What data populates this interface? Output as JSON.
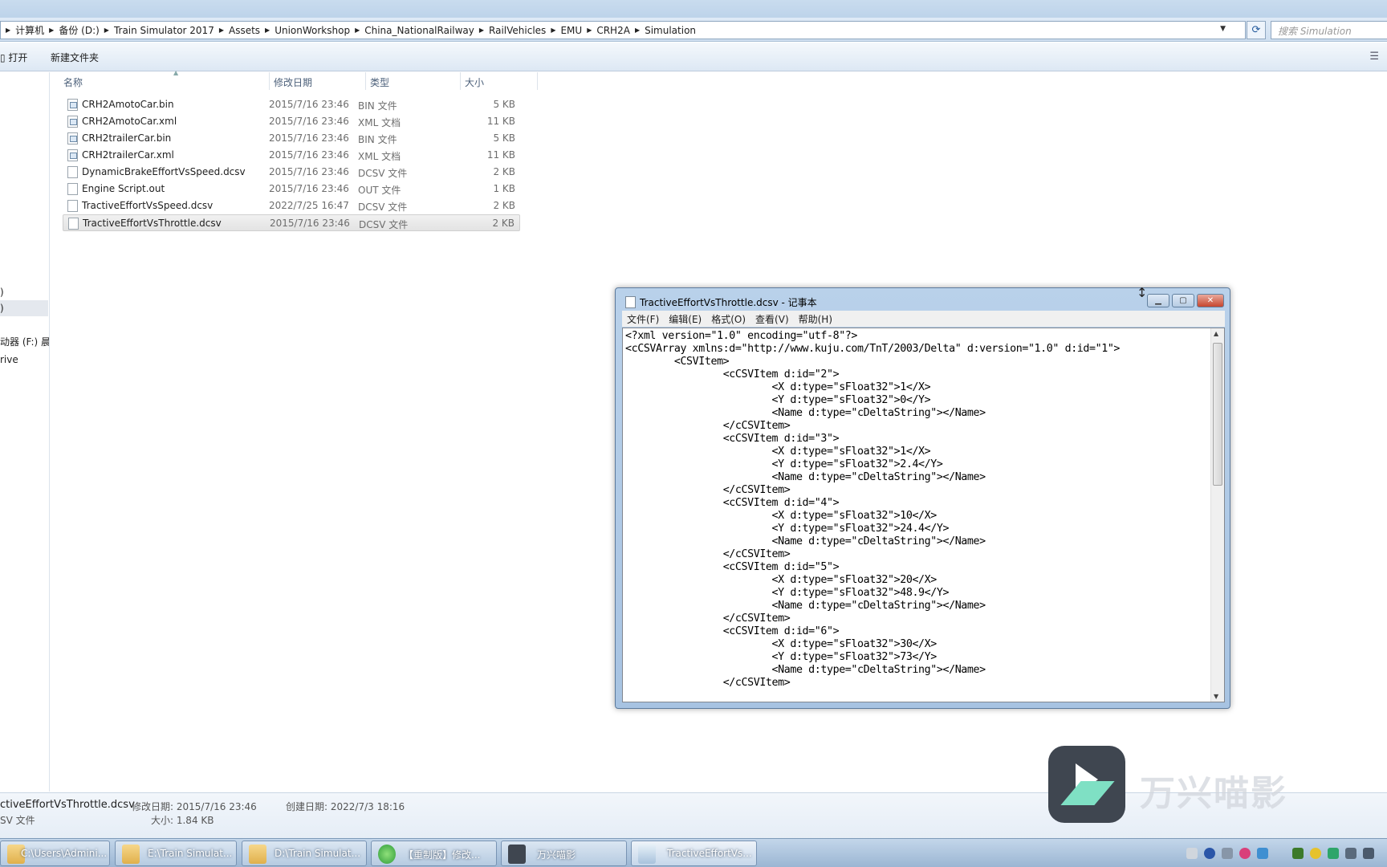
{
  "addressbar": {
    "breadcrumbs": [
      "计算机",
      "备份 (D:)",
      "Train Simulator 2017",
      "Assets",
      "UnionWorkshop",
      "China_NationalRailway",
      "RailVehicles",
      "EMU",
      "CRH2A",
      "Simulation"
    ],
    "search_placeholder": "搜索 Simulation"
  },
  "toolbar": {
    "open_label": "打开",
    "new_folder_label": "新建文件夹"
  },
  "navpane": {
    "item_a": ")",
    "item_b": ")",
    "item_c": "动器 (F:) 晨",
    "item_d": "rive"
  },
  "columns": {
    "name": "名称",
    "date": "修改日期",
    "type": "类型",
    "size": "大小"
  },
  "files": [
    {
      "name": "CRH2AmotoCar.bin",
      "date": "2015/7/16 23:46",
      "type": "BIN 文件",
      "size": "5 KB",
      "icon": "bin-file-icon"
    },
    {
      "name": "CRH2AmotoCar.xml",
      "date": "2015/7/16 23:46",
      "type": "XML 文档",
      "size": "11 KB",
      "icon": "xml-file-icon"
    },
    {
      "name": "CRH2trailerCar.bin",
      "date": "2015/7/16 23:46",
      "type": "BIN 文件",
      "size": "5 KB",
      "icon": "bin-file-icon"
    },
    {
      "name": "CRH2trailerCar.xml",
      "date": "2015/7/16 23:46",
      "type": "XML 文档",
      "size": "11 KB",
      "icon": "xml-file-icon"
    },
    {
      "name": "DynamicBrakeEffortVsSpeed.dcsv",
      "date": "2015/7/16 23:46",
      "type": "DCSV 文件",
      "size": "2 KB",
      "icon": "dcsv-file-icon"
    },
    {
      "name": "Engine Script.out",
      "date": "2015/7/16 23:46",
      "type": "OUT 文件",
      "size": "1 KB",
      "icon": "out-file-icon"
    },
    {
      "name": "TractiveEffortVsSpeed.dcsv",
      "date": "2022/7/25 16:47",
      "type": "DCSV 文件",
      "size": "2 KB",
      "icon": "dcsv-file-icon"
    },
    {
      "name": "TractiveEffortVsThrottle.dcsv",
      "date": "2015/7/16 23:46",
      "type": "DCSV 文件",
      "size": "2 KB",
      "icon": "dcsv-file-icon",
      "selected": true
    }
  ],
  "details": {
    "filename": "ctiveEffortVsThrottle.dcsv",
    "modified_label": "修改日期: 2015/7/16 23:46",
    "created_label": "创建日期: 2022/7/3 18:16",
    "type": "SV 文件",
    "size_label": "大小: 1.84 KB"
  },
  "notepad": {
    "title": "TractiveEffortVsThrottle.dcsv - 记事本",
    "menu": [
      "文件(F)",
      "编辑(E)",
      "格式(O)",
      "查看(V)",
      "帮助(H)"
    ],
    "content": "<?xml version=\"1.0\" encoding=\"utf-8\"?>\n<cCSVArray xmlns:d=\"http://www.kuju.com/TnT/2003/Delta\" d:version=\"1.0\" d:id=\"1\">\n\t<CSVItem>\n\t\t<cCSVItem d:id=\"2\">\n\t\t\t<X d:type=\"sFloat32\">1</X>\n\t\t\t<Y d:type=\"sFloat32\">0</Y>\n\t\t\t<Name d:type=\"cDeltaString\"></Name>\n\t\t</cCSVItem>\n\t\t<cCSVItem d:id=\"3\">\n\t\t\t<X d:type=\"sFloat32\">1</X>\n\t\t\t<Y d:type=\"sFloat32\">2.4</Y>\n\t\t\t<Name d:type=\"cDeltaString\"></Name>\n\t\t</cCSVItem>\n\t\t<cCSVItem d:id=\"4\">\n\t\t\t<X d:type=\"sFloat32\">10</X>\n\t\t\t<Y d:type=\"sFloat32\">24.4</Y>\n\t\t\t<Name d:type=\"cDeltaString\"></Name>\n\t\t</cCSVItem>\n\t\t<cCSVItem d:id=\"5\">\n\t\t\t<X d:type=\"sFloat32\">20</X>\n\t\t\t<Y d:type=\"sFloat32\">48.9</Y>\n\t\t\t<Name d:type=\"cDeltaString\"></Name>\n\t\t</cCSVItem>\n\t\t<cCSVItem d:id=\"6\">\n\t\t\t<X d:type=\"sFloat32\">30</X>\n\t\t\t<Y d:type=\"sFloat32\">73</Y>\n\t\t\t<Name d:type=\"cDeltaString\"></Name>\n\t\t</cCSVItem>"
  },
  "watermark": {
    "text": "万兴喵影"
  },
  "taskbar": {
    "items": [
      {
        "label": "C:\\Users\\Admini...",
        "icon": "folder-icon"
      },
      {
        "label": "E:\\Train Simulat...",
        "icon": "folder-icon"
      },
      {
        "label": "D:\\Train Simulat...",
        "icon": "folder-icon"
      },
      {
        "label": "【重制版】修改...",
        "icon": "browser-icon"
      },
      {
        "label": "万兴喵影",
        "icon": "filmora-icon"
      },
      {
        "label": "TractiveEffortVs...",
        "icon": "notepad-icon"
      }
    ]
  },
  "colors": {
    "selection": "#e3e3e3",
    "titlebar": "#bdd3ea",
    "close_button": "#c6452e",
    "watermark_accent": "#7fe0c4"
  }
}
